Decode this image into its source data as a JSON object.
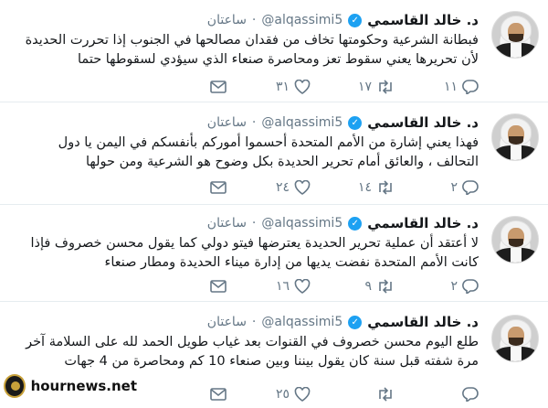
{
  "tweets": [
    {
      "name": "د. خالد القاسمي",
      "handle": "@alqassimi5",
      "dot": "·",
      "time": "ساعتان",
      "lines": [
        "فبطانة الشرعية وحكومتها تخاف من فقدان مصالحها في الجنوب إذا تحررت الحديدة",
        "لأن تحريرها يعني سقوط تعز ومحاصرة صنعاء الذي سيؤدي لسقوطها حتما"
      ],
      "replies": "١١",
      "retweets": "١٧",
      "likes": "٣١"
    },
    {
      "name": "د. خالد القاسمي",
      "handle": "@alqassimi5",
      "dot": "·",
      "time": "ساعتان",
      "lines": [
        "فهذا يعني إشارة من الأمم المتحدة أحسموا أموركم بأنفسكم في اليمن يا دول",
        "التحالف ، والعائق أمام تحرير الحديدة بكل وضوح هو الشرعية ومن حولها"
      ],
      "replies": "٢",
      "retweets": "١٤",
      "likes": "٢٤"
    },
    {
      "name": "د. خالد القاسمي",
      "handle": "@alqassimi5",
      "dot": "·",
      "time": "ساعتان",
      "lines": [
        "لا أعتقد أن عملية تحرير الحديدة يعترضها فيتو دولي كما يقول محسن خصروف فإذا",
        "كانت الأمم المتحدة نفضت يديها من إدارة ميناء الحديدة ومطار صنعاء"
      ],
      "replies": "٢",
      "retweets": "٩",
      "likes": "١٦"
    },
    {
      "name": "د. خالد القاسمي",
      "handle": "@alqassimi5",
      "dot": "·",
      "time": "ساعتان",
      "lines": [
        "طلع اليوم محسن خصروف في القنوات بعد غياب طويل الحمد لله على السلامة آخر",
        "مرة شفته قبل سنة كان يقول بيننا وبين صنعاء 10 كم ومحاصرة من 4 جهات"
      ],
      "replies": "",
      "retweets": "",
      "likes": "٢٥"
    }
  ],
  "watermark": {
    "text": "hournews.net"
  },
  "colors": {
    "verified": "#1da1f2",
    "meta": "#657786",
    "text": "#14171a",
    "divider": "#e6ecf0"
  },
  "icons": [
    "reply-icon",
    "retweet-icon",
    "like-icon",
    "message-icon",
    "verified-icon"
  ]
}
